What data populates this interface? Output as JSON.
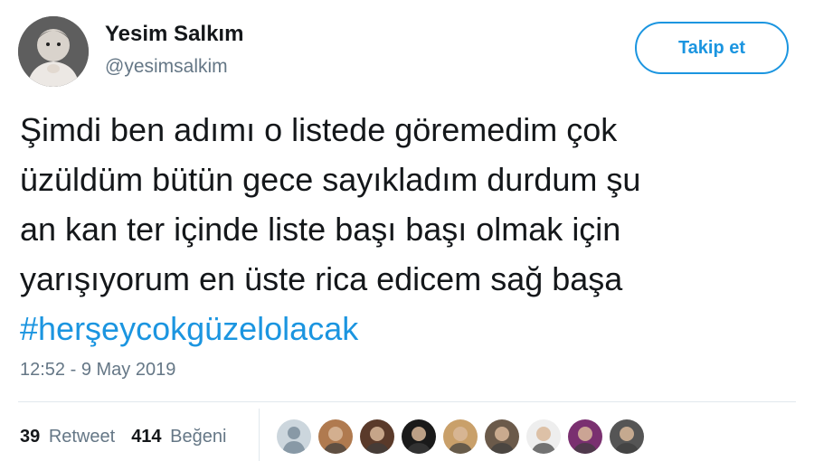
{
  "user": {
    "name": "Yesim Salkım",
    "handle": "@yesimsalkim",
    "avatar_icon": "baby-photo-avatar"
  },
  "follow_button": {
    "label": "Takip et",
    "color": "#1b95e0"
  },
  "tweet": {
    "lines": [
      "Şimdi ben adımı o listede göremedim çok",
      "üzüldüm bütün gece sayıkladım durdum şu",
      "an kan ter içinde liste başı başı olmak için",
      "yarışıyorum en üste rica edicem sağ başa"
    ],
    "hashtag": "#herşeycokgüzelolacak",
    "hashtag_color": "#1b95e0"
  },
  "timestamp": "12:52 - 9 May 2019",
  "stats": {
    "retweets_count": "39",
    "retweets_label": "Retweet",
    "likes_count": "414",
    "likes_label": "Beğeni"
  },
  "likers": [
    {
      "icon": "default-profile-icon",
      "color": "#8899a6"
    },
    {
      "icon": "user-avatar-icon",
      "color": "#b07a4f"
    },
    {
      "icon": "user-avatar-icon",
      "color": "#5a3a2a"
    },
    {
      "icon": "user-avatar-icon",
      "color": "#1a1a1a"
    },
    {
      "icon": "user-avatar-icon",
      "color": "#c9a06a"
    },
    {
      "icon": "user-avatar-icon",
      "color": "#6b5a4a"
    },
    {
      "icon": "user-avatar-icon",
      "color": "#eeeeee"
    },
    {
      "icon": "user-avatar-icon",
      "color": "#7a3070"
    },
    {
      "icon": "user-avatar-icon",
      "color": "#555555"
    }
  ]
}
